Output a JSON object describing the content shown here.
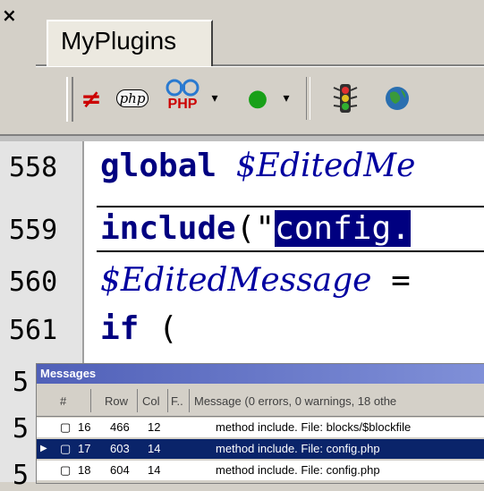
{
  "window": {
    "close_glyph": "×"
  },
  "tabs": [
    {
      "label": "MyPlugins"
    }
  ],
  "toolbar": {
    "items": [
      {
        "name": "not-equal-icon",
        "glyph": "≠",
        "color": "#cc0000"
      },
      {
        "name": "php-cloud-icon",
        "glyph": "php"
      },
      {
        "name": "php-debug-icon",
        "glyph": "PHP",
        "color": "#cc0000",
        "accent": "#2a7ad0"
      },
      {
        "name": "green-dot-icon",
        "glyph": "●",
        "color": "#18a018"
      },
      {
        "name": "traffic-light-icon",
        "glyph": "≋"
      },
      {
        "name": "globe-icon",
        "glyph": "◉",
        "color": "#2a6fb0"
      }
    ],
    "dropdown_glyph": "▾"
  },
  "editor": {
    "lines": [
      {
        "no": "558",
        "parts": [
          {
            "t": "global",
            "c": "kw"
          },
          {
            "t": " ",
            "c": "op"
          },
          {
            "t": "$EditedMe",
            "c": "var"
          }
        ]
      },
      {
        "no": "559",
        "parts": [
          {
            "t": "include",
            "c": "kw"
          },
          {
            "t": "(\"",
            "c": "paren"
          },
          {
            "t": "config.",
            "c": "str-sel"
          }
        ]
      },
      {
        "no": "560",
        "parts": [
          {
            "t": "$EditedMessage",
            "c": "var"
          },
          {
            "t": " =",
            "c": "op"
          }
        ]
      },
      {
        "no": "561",
        "parts": [
          {
            "t": "if",
            "c": "kw"
          },
          {
            "t": " (",
            "c": "paren"
          }
        ]
      }
    ],
    "edge_numbers": [
      "5",
      "5",
      "5"
    ]
  },
  "messages": {
    "title": "Messages",
    "headers": [
      "#",
      "Row",
      "Col",
      "F..",
      "Message (0 errors, 0 warnings, 18 othe"
    ],
    "rows": [
      {
        "num": "16",
        "row": "466",
        "col": "12",
        "file": "",
        "message": "method include. File: blocks/$blockfile",
        "selected": false
      },
      {
        "num": "17",
        "row": "603",
        "col": "14",
        "file": "",
        "message": "method include. File: config.php",
        "selected": true
      },
      {
        "num": "18",
        "row": "604",
        "col": "14",
        "file": "",
        "message": "method include. File: config.php",
        "selected": false
      }
    ]
  },
  "colors": {
    "selection": "#0a246a",
    "keyword": "#000080",
    "variable": "#0000a0"
  }
}
